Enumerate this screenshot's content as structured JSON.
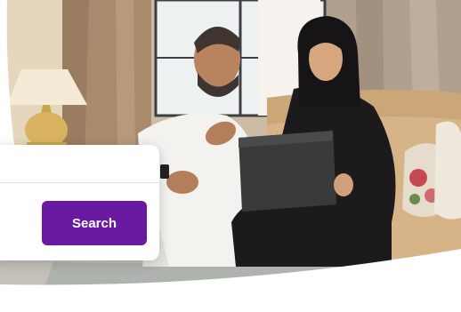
{
  "hero": {
    "image": "family-living-room-photo",
    "colors": {
      "curtain": "#a88b6c",
      "sofa": "#d7b488",
      "abaya": "#1c1a1d",
      "thobe": "#f3f2ee",
      "tablet": "#3a3a3c"
    }
  },
  "search_card": {
    "button_label": "Search",
    "button_color": "#6a1aa0"
  }
}
